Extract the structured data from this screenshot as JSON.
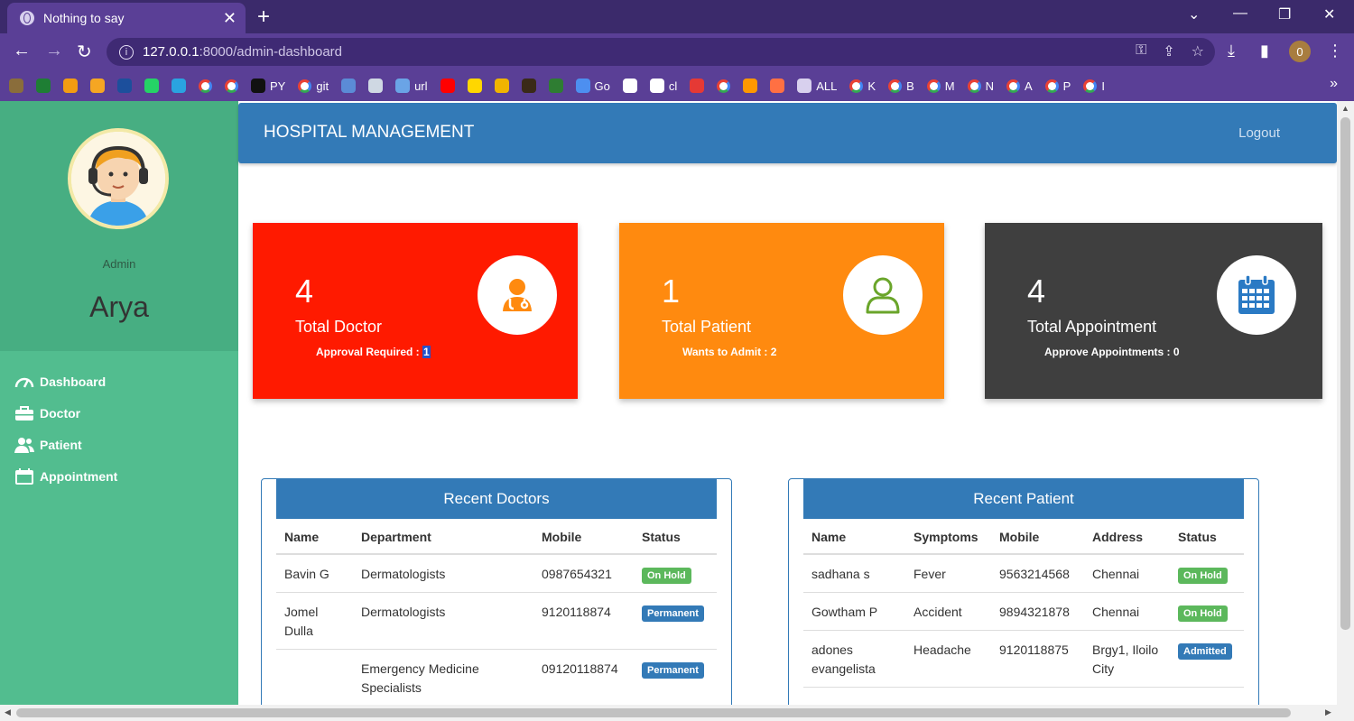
{
  "browser": {
    "tab_title": "Nothing to say",
    "url_host": "127.0.0.1",
    "url_path": ":8000/admin-dashboard",
    "profile_initial": "0",
    "bookmarks": [
      {
        "label": "",
        "color": "#8a6d3b"
      },
      {
        "label": "",
        "color": "#1e7e34"
      },
      {
        "label": "",
        "color": "#f39c12"
      },
      {
        "label": "",
        "color": "#f5a623"
      },
      {
        "label": "",
        "color": "#1c4f9c"
      },
      {
        "label": "",
        "color": "#25d366"
      },
      {
        "label": "",
        "color": "#2aa3e0"
      },
      {
        "label": "",
        "type": "g"
      },
      {
        "label": "",
        "type": "g"
      },
      {
        "label": "PY",
        "color": "#111111"
      },
      {
        "label": "git",
        "type": "g"
      },
      {
        "label": "",
        "color": "#5b8bd6"
      },
      {
        "label": "",
        "color": "#cfd8e3"
      },
      {
        "label": "url",
        "color": "#6aa4e6"
      },
      {
        "label": "",
        "color": "#ff0000"
      },
      {
        "label": "",
        "color": "#ffd700"
      },
      {
        "label": "",
        "color": "#f0b400"
      },
      {
        "label": "",
        "color": "#3a2a18"
      },
      {
        "label": "",
        "color": "#2e7d32"
      },
      {
        "label": "Go",
        "color": "#4d8ff0"
      },
      {
        "label": "",
        "color": "#ffffff"
      },
      {
        "label": "cl",
        "color": "#ffffff"
      },
      {
        "label": "",
        "color": "#e53935"
      },
      {
        "label": "",
        "type": "g"
      },
      {
        "label": "",
        "color": "#ff9800"
      },
      {
        "label": "",
        "color": "#ff7043"
      },
      {
        "label": "ALL",
        "color": "#d8d0ee"
      },
      {
        "label": "K",
        "type": "g"
      },
      {
        "label": "B",
        "type": "g"
      },
      {
        "label": "M",
        "type": "g"
      },
      {
        "label": "N",
        "type": "g"
      },
      {
        "label": "A",
        "type": "g"
      },
      {
        "label": "P",
        "type": "g"
      },
      {
        "label": "I",
        "type": "g"
      }
    ]
  },
  "sidebar": {
    "role": "Admin",
    "username": "Arya",
    "items": [
      {
        "label": "Dashboard",
        "icon": "gauge-icon"
      },
      {
        "label": "Doctor",
        "icon": "briefcase-icon"
      },
      {
        "label": "Patient",
        "icon": "users-icon"
      },
      {
        "label": "Appointment",
        "icon": "calendar-icon"
      }
    ]
  },
  "header": {
    "brand": "HOSPITAL MANAGEMENT",
    "logout": "Logout"
  },
  "cards": {
    "doctor": {
      "count": "4",
      "label": "Total Doctor",
      "sub_label": "Approval Required : ",
      "sub_value": "1",
      "color": "#ff1a00"
    },
    "patient": {
      "count": "1",
      "label": "Total Patient",
      "sub_label": "Wants to Admit : 2",
      "color": "#ff8a0f"
    },
    "appointment": {
      "count": "4",
      "label": "Total Appointment",
      "sub_label": "Approve Appointments : 0",
      "color": "#3f3f3f"
    }
  },
  "recent_doctors": {
    "title": "Recent Doctors",
    "headers": [
      "Name",
      "Department",
      "Mobile",
      "Status"
    ],
    "rows": [
      {
        "name": "Bavin G",
        "department": "Dermatologists",
        "mobile": "0987654321",
        "status": "On Hold"
      },
      {
        "name": "Jomel Dulla",
        "department": "Dermatologists",
        "mobile": "9120118874",
        "status": "Permanent"
      },
      {
        "name": "",
        "department": "Emergency Medicine Specialists",
        "mobile": "09120118874",
        "status": "Permanent"
      }
    ]
  },
  "recent_patients": {
    "title": "Recent Patient",
    "headers": [
      "Name",
      "Symptoms",
      "Mobile",
      "Address",
      "Status"
    ],
    "rows": [
      {
        "name": "sadhana s",
        "symptoms": "Fever",
        "mobile": "9563214568",
        "address": "Chennai",
        "status": "On Hold"
      },
      {
        "name": "Gowtham P",
        "symptoms": "Accident",
        "mobile": "9894321878",
        "address": "Chennai",
        "status": "On Hold"
      },
      {
        "name": "adones evangelista",
        "symptoms": "Headache",
        "mobile": "9120118875",
        "address": "Brgy1, Iloilo City",
        "status": "Admitted"
      }
    ]
  }
}
